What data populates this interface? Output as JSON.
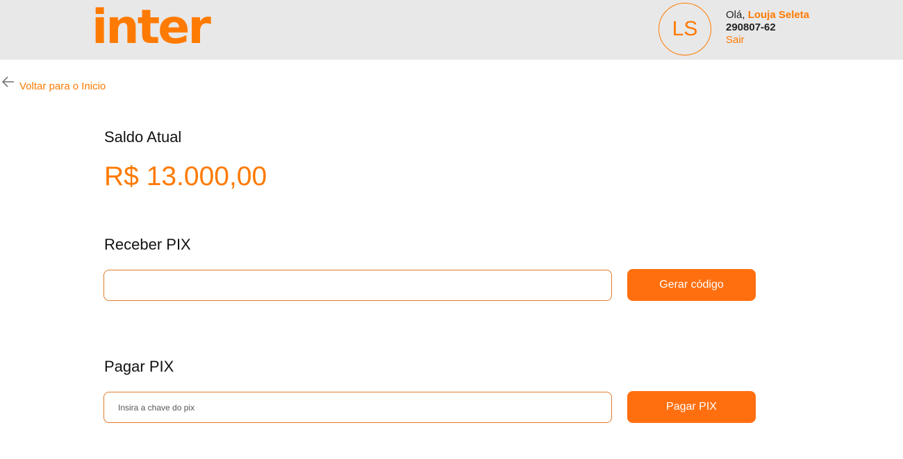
{
  "header": {
    "logo_text": "inter",
    "avatar_initials": "LS",
    "greeting_prefix": "Olá,",
    "user_name": "Louja Seleta",
    "account_number": "290807-62",
    "logout_label": "Sair"
  },
  "navigation": {
    "back_label": "Voltar para o Inicio"
  },
  "balance": {
    "title": "Saldo Atual",
    "value": "R$ 13.000,00"
  },
  "receive_pix": {
    "title": "Receber PIX",
    "input_value": "",
    "input_placeholder": "",
    "button_label": "Gerar código"
  },
  "pay_pix": {
    "title": "Pagar PIX",
    "input_value": "",
    "input_placeholder": "Insira a chave do pix",
    "button_label": "Pagar PIX"
  },
  "colors": {
    "accent": "#ff7a00",
    "button": "#ff6f0f",
    "header_bg": "#e8e8e8"
  },
  "icons": {
    "back": "arrow-left-icon"
  }
}
